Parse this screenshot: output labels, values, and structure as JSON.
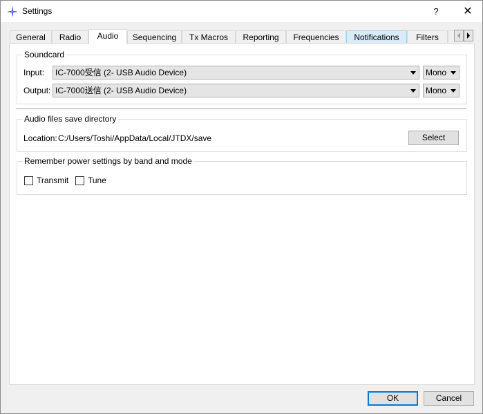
{
  "window": {
    "title": "Settings",
    "help_label": "?",
    "close_label": "✕"
  },
  "tabs": [
    {
      "label": "General"
    },
    {
      "label": "Radio"
    },
    {
      "label": "Audio"
    },
    {
      "label": "Sequencing"
    },
    {
      "label": "Tx Macros"
    },
    {
      "label": "Reporting"
    },
    {
      "label": "Frequencies"
    },
    {
      "label": "Notifications"
    },
    {
      "label": "Filters"
    }
  ],
  "active_tab": "Audio",
  "soundcard": {
    "title": "Soundcard",
    "input_label": "Input:",
    "input_device": "IC-7000受信 (2- USB Audio Device)",
    "input_channel": "Mono",
    "output_label": "Output:",
    "output_device": "IC-7000送信 (2- USB Audio Device)",
    "output_channel": "Mono"
  },
  "save_dir": {
    "title": "Audio files save directory",
    "location_label": "Location:",
    "location_value": "C:/Users/Toshi/AppData/Local/JTDX/save",
    "select_label": "Select"
  },
  "power": {
    "title": "Remember power settings by band and mode",
    "transmit_label": "Transmit",
    "transmit_checked": false,
    "tune_label": "Tune",
    "tune_checked": false
  },
  "footer": {
    "ok_label": "OK",
    "cancel_label": "Cancel"
  }
}
